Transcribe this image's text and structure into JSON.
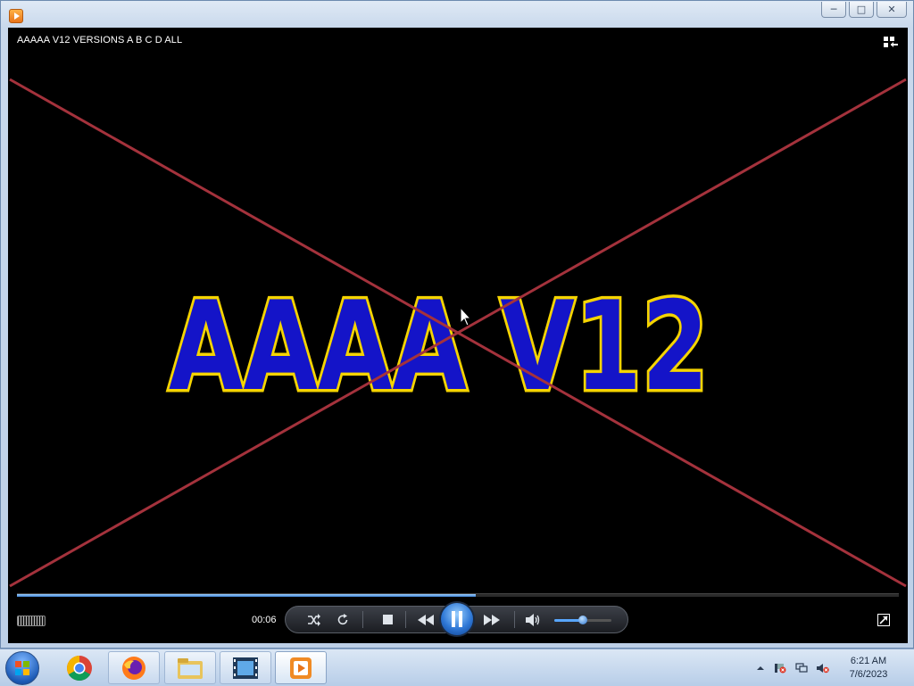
{
  "window": {
    "video_title": "AAAAA V12 VERSIONS A B C D ALL"
  },
  "frame": {
    "text": "AAAA V12"
  },
  "player": {
    "elapsed": "00:06",
    "progress": 0.52,
    "volume": 0.5
  },
  "taskbar": {
    "items": [
      {
        "icon": "chrome-icon"
      },
      {
        "icon": "firefox-icon"
      },
      {
        "icon": "file-explorer-icon"
      },
      {
        "icon": "movie-maker-icon"
      },
      {
        "icon": "media-player-icon"
      }
    ],
    "tray": [
      "tray-expand-icon",
      "action-center-icon",
      "network-icon",
      "volume-muted-icon"
    ],
    "time": "6:21 AM",
    "date": "7/6/2023"
  },
  "colors": {
    "text_fill": "#1414c8",
    "text_stroke": "#f5d400",
    "cross_line": "#a4323c",
    "accent": "#3b7fd1"
  }
}
